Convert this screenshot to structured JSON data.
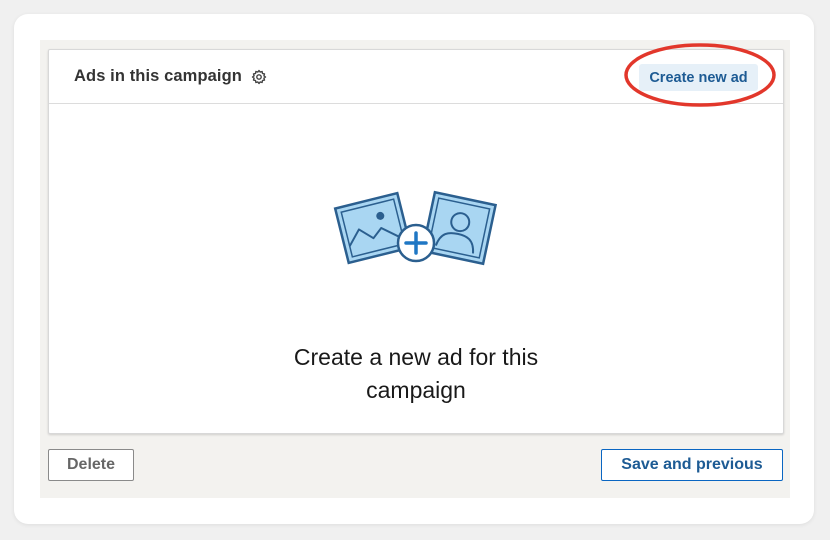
{
  "panel": {
    "title": "Ads in this campaign",
    "settings_icon": "gear-icon",
    "create_button_label": "Create new ad"
  },
  "empty_state": {
    "illustration_icon": "image-and-profile-with-add-icon",
    "message": "Create a new ad for this campaign"
  },
  "footer": {
    "delete_label": "Delete",
    "save_label": "Save and previous"
  },
  "colors": {
    "accent_blue": "#0a66c2",
    "button_highlight_bg": "#e6f0f8",
    "annotation_red": "#e2372b",
    "illustration_fill": "#a9d6f2",
    "illustration_stroke": "#2b5f8f"
  }
}
